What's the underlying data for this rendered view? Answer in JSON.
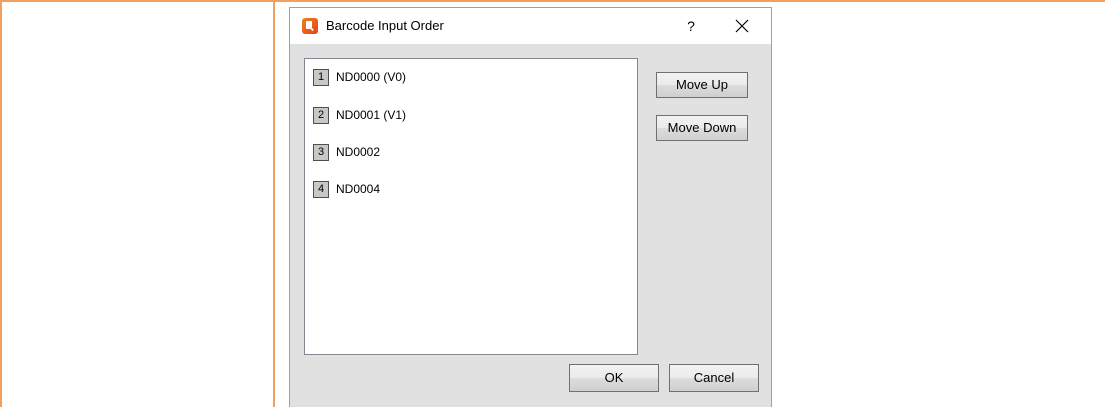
{
  "dialog": {
    "title": "Barcode Input Order",
    "help_glyph": "?",
    "close_icon": "close-icon",
    "app_icon": "app-logo-icon",
    "list_items": [
      {
        "index": "1",
        "label": "ND0000 (V0)"
      },
      {
        "index": "2",
        "label": "ND0001 (V1)"
      },
      {
        "index": "3",
        "label": "ND0002"
      },
      {
        "index": "4",
        "label": "ND0004"
      }
    ],
    "move_up_label": "Move Up",
    "move_down_label": "Move Down",
    "ok_label": "OK",
    "cancel_label": "Cancel"
  },
  "colors": {
    "frame_border": "#f0a060",
    "dialog_bg": "#e1e1e1",
    "titlebar_bg": "#ffffff",
    "badge_bg": "#c8c8c8"
  }
}
